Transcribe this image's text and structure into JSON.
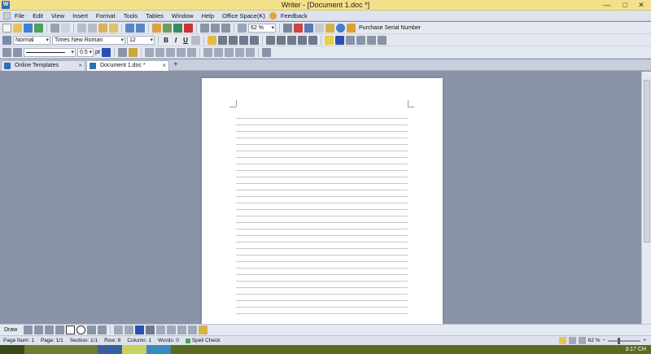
{
  "window": {
    "title": "Writer - [Document 1.doc *]",
    "app_icon_letter": "W",
    "minimize": "—",
    "maximize": "□",
    "close": "✕"
  },
  "menu": [
    "File",
    "Edit",
    "View",
    "Insert",
    "Format",
    "Tools",
    "Tables",
    "Window",
    "Help",
    "Office Space(K)",
    "Feedback"
  ],
  "toolbar": {
    "zoom_value": "62 %",
    "purchase_label": "Purchase Serial Number",
    "style_value": "Normal",
    "font_value": "Times New Roman",
    "size_value": "12",
    "line_width_value": "0.5",
    "line_width_unit": "pt",
    "bold": "B",
    "italic": "I",
    "underline": "U"
  },
  "tabs": [
    {
      "label": "Online Templates",
      "active": false
    },
    {
      "label": "Document 1.doc *",
      "active": true
    }
  ],
  "new_tab": "+",
  "draw": {
    "label": "Draw"
  },
  "status": {
    "page_num": "Page Num: 1",
    "page": "Page: 1/1",
    "section": "Section: 1/1",
    "row": "Row: 8",
    "column": "Column: 1",
    "words": "Words: 0",
    "spell": "Spell Check",
    "zoom": "62 %"
  },
  "taskbar": {
    "clock": "3:17 CH"
  },
  "colors": {
    "titlebar": "#f3e08a",
    "taskbar": "#5a6a1e",
    "accent_blue": "#2f6db5"
  }
}
